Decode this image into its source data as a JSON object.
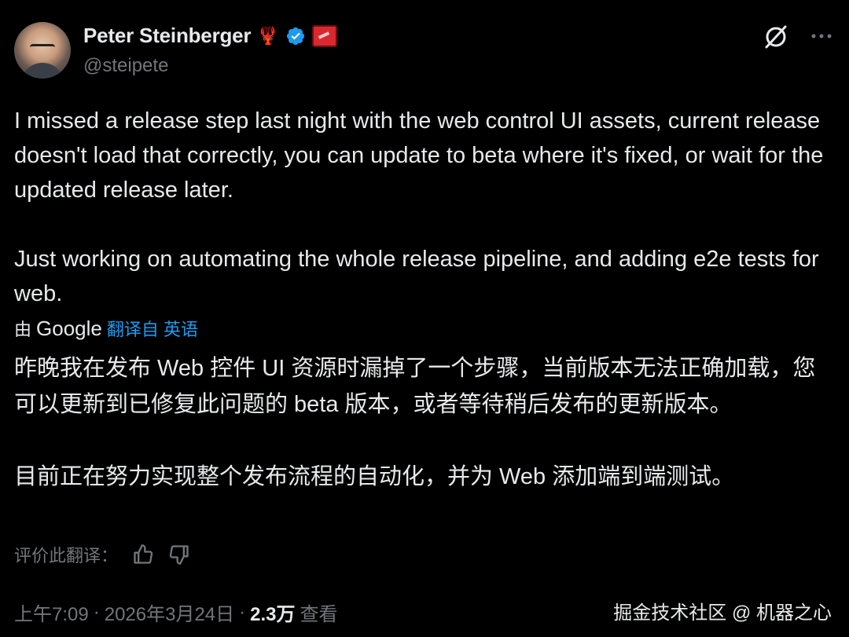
{
  "author": {
    "name": "Peter Steinberger",
    "handle": "@steipete",
    "name_emoji": "🦞"
  },
  "tweet": {
    "text": "I missed a release step last night with the web control UI assets, current release doesn't load that correctly, you can update to beta where it's fixed, or wait for the updated release later.\n\nJust working on automating the whole release pipeline, and adding e2e tests for web."
  },
  "translation": {
    "prefix": "由",
    "provider": "Google",
    "link_label": "翻译自 英语",
    "text": "昨晚我在发布 Web 控件 UI 资源时漏掉了一个步骤，当前版本无法正确加载，您可以更新到已修复此问题的 beta 版本，或者等待稍后发布的更新版本。\n\n目前正在努力实现整个发布流程的自动化，并为 Web 添加端到端测试。",
    "rate_label": "评价此翻译："
  },
  "meta": {
    "time": "上午7:09",
    "date": "2026年3月24日",
    "sep": "·",
    "views_count": "2.3万",
    "views_label": "查看"
  },
  "watermark": "掘金技术社区 @ 机器之心",
  "colors": {
    "background": "#000000",
    "text": "#e7e9ea",
    "muted": "#71767b",
    "link": "#1d9bf0",
    "verified": "#1d9bf0"
  },
  "icons": [
    "grok-icon",
    "more-icon",
    "verified-icon",
    "thumbs-up-icon",
    "thumbs-down-icon"
  ]
}
